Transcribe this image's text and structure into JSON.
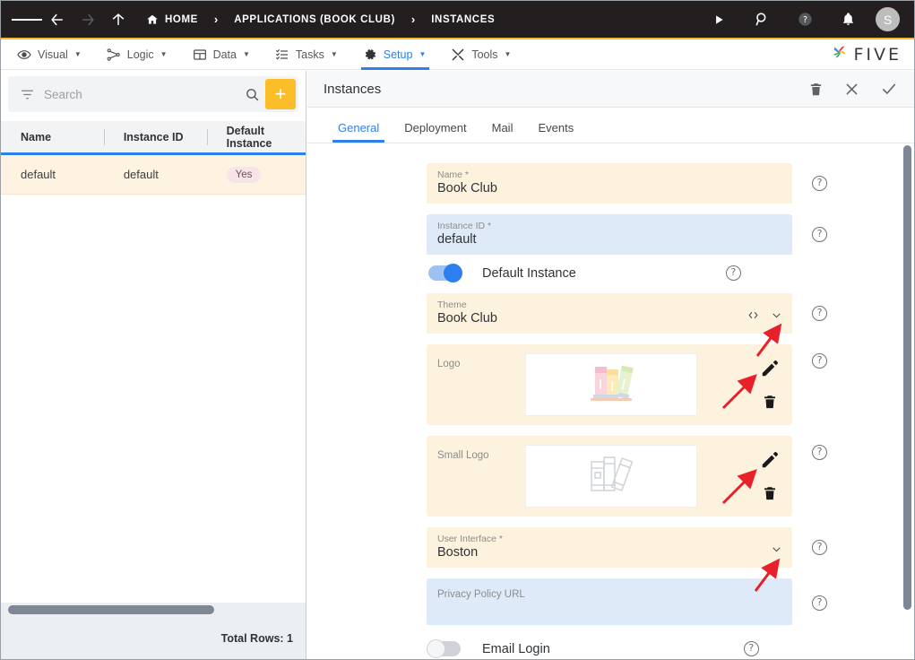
{
  "topbar": {
    "menu_icon": "hamburger-icon",
    "back_icon": "arrow-left-icon",
    "forward_icon": "arrow-right-icon",
    "up_icon": "arrow-up-icon",
    "breadcrumbs": [
      {
        "label": "HOME",
        "icon": "home-icon"
      },
      {
        "label": "APPLICATIONS (BOOK CLUB)",
        "icon": ""
      },
      {
        "label": "INSTANCES",
        "icon": ""
      }
    ],
    "separator": "›",
    "run_icon": "play-icon",
    "search_icon": "magnifier-icon",
    "help_icon": "question-circle-icon",
    "bell_icon": "bell-icon",
    "avatar_initial": "S",
    "background": "#231f20",
    "accent": "#f5b92b"
  },
  "menubar": {
    "items": [
      {
        "label": "Visual",
        "icon": "eye-icon",
        "active": false
      },
      {
        "label": "Logic",
        "icon": "logic-nodes-icon",
        "active": false
      },
      {
        "label": "Data",
        "icon": "table-icon",
        "active": false
      },
      {
        "label": "Tasks",
        "icon": "checklist-icon",
        "active": false
      },
      {
        "label": "Setup",
        "icon": "gear-icon",
        "active": true
      },
      {
        "label": "Tools",
        "icon": "tools-icon",
        "active": false
      }
    ],
    "caret": "▼",
    "brand": "FIVE",
    "active_color": "#2d7ff0"
  },
  "left_panel": {
    "search": {
      "placeholder": "Search",
      "value": "",
      "filter_icon": "filter-icon",
      "search_icon": "search-icon"
    },
    "add_button_label": "+",
    "add_button_color": "#fbbe28",
    "columns": [
      "Name",
      "Instance ID",
      "Default Instance"
    ],
    "rows": [
      {
        "name": "default",
        "instance_id": "default",
        "default_instance": "Yes"
      }
    ],
    "footer": "Total Rows: 1"
  },
  "right_panel": {
    "title": "Instances",
    "actions": [
      {
        "name": "delete",
        "icon": "trash-icon"
      },
      {
        "name": "close",
        "icon": "close-icon"
      },
      {
        "name": "save",
        "icon": "check-icon"
      }
    ],
    "tabs": [
      {
        "label": "General",
        "active": true
      },
      {
        "label": "Deployment",
        "active": false
      },
      {
        "label": "Mail",
        "active": false
      },
      {
        "label": "Events",
        "active": false
      }
    ],
    "form": {
      "name": {
        "label": "Name *",
        "value": "Book Club",
        "style": "tan"
      },
      "instance_id": {
        "label": "Instance ID *",
        "value": "default",
        "style": "blue"
      },
      "default_instance": {
        "label": "Default Instance",
        "state": "on"
      },
      "theme": {
        "label": "Theme",
        "value": "Book Club",
        "style": "tan",
        "code_icon": "code-brackets-icon",
        "chevron_icon": "chevron-down-icon"
      },
      "logo": {
        "label": "Logo",
        "image": "books-color-illustration",
        "edit_icon": "pencil-icon",
        "delete_icon": "trash-icon"
      },
      "small_logo": {
        "label": "Small Logo",
        "image": "books-outline-illustration",
        "edit_icon": "pencil-icon",
        "delete_icon": "trash-icon"
      },
      "user_interface": {
        "label": "User Interface *",
        "value": "Boston",
        "style": "tan",
        "chevron_icon": "chevron-down-icon"
      },
      "privacy_policy_url": {
        "label": "Privacy Policy URL",
        "value": "",
        "style": "blue"
      },
      "email_login": {
        "label": "Email Login",
        "state": "off"
      },
      "help_icon": "question-circle-icon"
    }
  },
  "annotations": {
    "arrow_color": "#e8202a",
    "arrows": [
      "theme-dropdown-arrow",
      "logo-edit-arrow",
      "small-logo-edit-arrow",
      "user-interface-dropdown-arrow"
    ]
  }
}
